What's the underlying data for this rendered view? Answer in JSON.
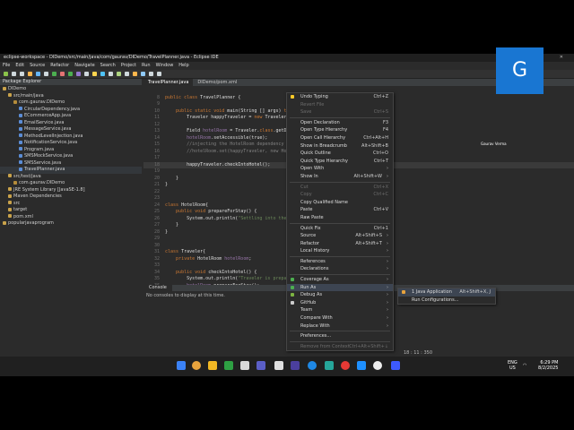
{
  "window": {
    "title": "eclipse-workspace - DIDemo/src/main/java/com/gaurav/DIDemo/TravelPlanner.java - Eclipse IDE"
  },
  "menubar": [
    "File",
    "Edit",
    "Source",
    "Refactor",
    "Navigate",
    "Search",
    "Project",
    "Run",
    "Window",
    "Help"
  ],
  "package_explorer": {
    "title": "Package Explorer",
    "items": [
      {
        "label": "DIDemo",
        "indent": 0
      },
      {
        "label": "src/main/java",
        "indent": 1
      },
      {
        "label": "com.gaurav.DIDemo",
        "indent": 2
      },
      {
        "label": "CircularDependency.java",
        "indent": 3
      },
      {
        "label": "ECommerceApp.java",
        "indent": 3
      },
      {
        "label": "EmailService.java",
        "indent": 3
      },
      {
        "label": "MessageService.java",
        "indent": 3
      },
      {
        "label": "MethodLevelInjection.java",
        "indent": 3
      },
      {
        "label": "NotificationService.java",
        "indent": 3
      },
      {
        "label": "Program.java",
        "indent": 3
      },
      {
        "label": "SMSMockService.java",
        "indent": 3
      },
      {
        "label": "SMSService.java",
        "indent": 3
      },
      {
        "label": "TravelPlanner.java",
        "indent": 3
      },
      {
        "label": "src/test/java",
        "indent": 1
      },
      {
        "label": "com.gaurav.DIDemo",
        "indent": 2
      },
      {
        "label": "JRE System Library [JavaSE-1.8]",
        "indent": 1
      },
      {
        "label": "Maven Dependencies",
        "indent": 1
      },
      {
        "label": "src",
        "indent": 1
      },
      {
        "label": "target",
        "indent": 1
      },
      {
        "label": "pom.xml",
        "indent": 1
      },
      {
        "label": "popularjavaprogram",
        "indent": 0
      }
    ]
  },
  "editor": {
    "tabs": [
      "TravelPlanner.java",
      "DIDemo/pom.xml"
    ],
    "lines": [
      {
        "n": "",
        "t": ""
      },
      {
        "n": "",
        "t": "public class TravelPlanner {"
      },
      {
        "n": "",
        "t": ""
      },
      {
        "n": "",
        "t": "    public static void main(String [] args) throws"
      },
      {
        "n": "",
        "t": "        Traveler happyTraveler = new Traveler();"
      },
      {
        "n": "",
        "t": ""
      },
      {
        "n": "",
        "t": "        Field hotelRoom = Traveler.class.getDecla"
      },
      {
        "n": "",
        "t": "        hotelRoom.setAccessible(true);"
      },
      {
        "n": "",
        "t": "        //injecting the HotelRoom dependency"
      },
      {
        "n": "",
        "t": "        //hotelRoom.set(happyTraveler, new HotelR"
      },
      {
        "n": "",
        "t": ""
      },
      {
        "n": "",
        "t": "        happyTraveler.checkIntoHotel();"
      },
      {
        "n": "",
        "t": ""
      },
      {
        "n": "",
        "t": "    }"
      },
      {
        "n": "",
        "t": "}"
      },
      {
        "n": "",
        "t": ""
      },
      {
        "n": "",
        "t": ""
      },
      {
        "n": "",
        "t": "class HotelRoom{"
      },
      {
        "n": "",
        "t": "    public void prepareForStay() {"
      },
      {
        "n": "",
        "t": "        System.out.println(\"Settling into the co"
      },
      {
        "n": "",
        "t": "    }"
      },
      {
        "n": "",
        "t": "}"
      },
      {
        "n": "",
        "t": ""
      },
      {
        "n": "",
        "t": ""
      },
      {
        "n": "",
        "t": "class Traveler{"
      },
      {
        "n": "",
        "t": "    private HotelRoom hotelRoom;"
      },
      {
        "n": "",
        "t": ""
      },
      {
        "n": "",
        "t": "    public void checkIntoHotel() {"
      },
      {
        "n": "",
        "t": "        System.out.println(\"Traveler is preparing"
      },
      {
        "n": "",
        "t": "        hotelRoom.prepareForStay();"
      },
      {
        "n": "",
        "t": "    }"
      },
      {
        "n": "",
        "t": "}"
      }
    ],
    "line_numbers": [
      "",
      "8",
      "9",
      "10",
      "11",
      "12",
      "13",
      "14",
      "15",
      "16",
      "17",
      "18",
      "19",
      "20",
      "21",
      "22",
      "23",
      "24",
      "25",
      "26",
      "27",
      "28",
      "29",
      "30",
      "31",
      "32",
      "33",
      "34",
      "35",
      "36",
      "37",
      "38"
    ]
  },
  "console": {
    "title": "Console",
    "message": "No consoles to display at this time."
  },
  "status": {
    "position": "18 : 11 : 350"
  },
  "context_menu": {
    "items": [
      {
        "label": "Undo Typing",
        "shortcut": "Ctrl+Z",
        "disabled": false
      },
      {
        "label": "Revert File",
        "shortcut": "",
        "disabled": true
      },
      {
        "label": "Save",
        "shortcut": "Ctrl+S",
        "disabled": true
      },
      {
        "sep": true
      },
      {
        "label": "Open Declaration",
        "shortcut": "F3",
        "disabled": false
      },
      {
        "label": "Open Type Hierarchy",
        "shortcut": "F4",
        "disabled": false
      },
      {
        "label": "Open Call Hierarchy",
        "shortcut": "Ctrl+Alt+H",
        "disabled": false
      },
      {
        "label": "Show in Breadcrumb",
        "shortcut": "Alt+Shift+B",
        "disabled": false
      },
      {
        "label": "Quick Outline",
        "shortcut": "Ctrl+O",
        "disabled": false
      },
      {
        "label": "Quick Type Hierarchy",
        "shortcut": "Ctrl+T",
        "disabled": false
      },
      {
        "label": "Open With",
        "shortcut": "",
        "arrow": true,
        "disabled": false
      },
      {
        "label": "Show In",
        "shortcut": "Alt+Shift+W",
        "arrow": true,
        "disabled": false
      },
      {
        "sep": true
      },
      {
        "label": "Cut",
        "shortcut": "Ctrl+X",
        "disabled": true
      },
      {
        "label": "Copy",
        "shortcut": "Ctrl+C",
        "disabled": true
      },
      {
        "label": "Copy Qualified Name",
        "shortcut": "",
        "disabled": false
      },
      {
        "label": "Paste",
        "shortcut": "Ctrl+V",
        "disabled": false
      },
      {
        "label": "Raw Paste",
        "shortcut": "",
        "disabled": false
      },
      {
        "sep": true
      },
      {
        "label": "Quick Fix",
        "shortcut": "Ctrl+1",
        "disabled": false
      },
      {
        "label": "Source",
        "shortcut": "Alt+Shift+S",
        "arrow": true,
        "disabled": false
      },
      {
        "label": "Refactor",
        "shortcut": "Alt+Shift+T",
        "arrow": true,
        "disabled": false
      },
      {
        "label": "Local History",
        "shortcut": "",
        "arrow": true,
        "disabled": false
      },
      {
        "sep": true
      },
      {
        "label": "References",
        "shortcut": "",
        "arrow": true,
        "disabled": false
      },
      {
        "label": "Declarations",
        "shortcut": "",
        "arrow": true,
        "disabled": false
      },
      {
        "sep": true
      },
      {
        "label": "Coverage As",
        "shortcut": "",
        "arrow": true,
        "disabled": false,
        "icon": "#4caf50"
      },
      {
        "label": "Run As",
        "shortcut": "",
        "arrow": true,
        "disabled": false,
        "icon": "#4caf50",
        "selected": true
      },
      {
        "label": "Debug As",
        "shortcut": "",
        "arrow": true,
        "disabled": false,
        "icon": "#7cb342"
      },
      {
        "label": "GitHub",
        "shortcut": "",
        "arrow": true,
        "disabled": false,
        "icon": "#cccccc"
      },
      {
        "label": "Team",
        "shortcut": "",
        "arrow": true,
        "disabled": false
      },
      {
        "label": "Compare With",
        "shortcut": "",
        "arrow": true,
        "disabled": false
      },
      {
        "label": "Replace With",
        "shortcut": "",
        "arrow": true,
        "disabled": false
      },
      {
        "sep": true
      },
      {
        "label": "Preferences...",
        "shortcut": "",
        "disabled": false
      },
      {
        "sep": true
      },
      {
        "label": "Remove from Context",
        "shortcut": "Ctrl+Alt+Shift+↓",
        "disabled": true
      }
    ]
  },
  "submenu": {
    "items": [
      {
        "label": "1 Java Application",
        "shortcut": "Alt+Shift+X, J"
      },
      {
        "label": "Run Configurations...",
        "shortcut": ""
      }
    ]
  },
  "participant": {
    "initial": "G",
    "name": "Gaurav Verma"
  },
  "taskbar": {
    "lang_top": "ENG",
    "lang_bottom": "US",
    "time": "6:29 PM",
    "date": "8/2/2025"
  }
}
